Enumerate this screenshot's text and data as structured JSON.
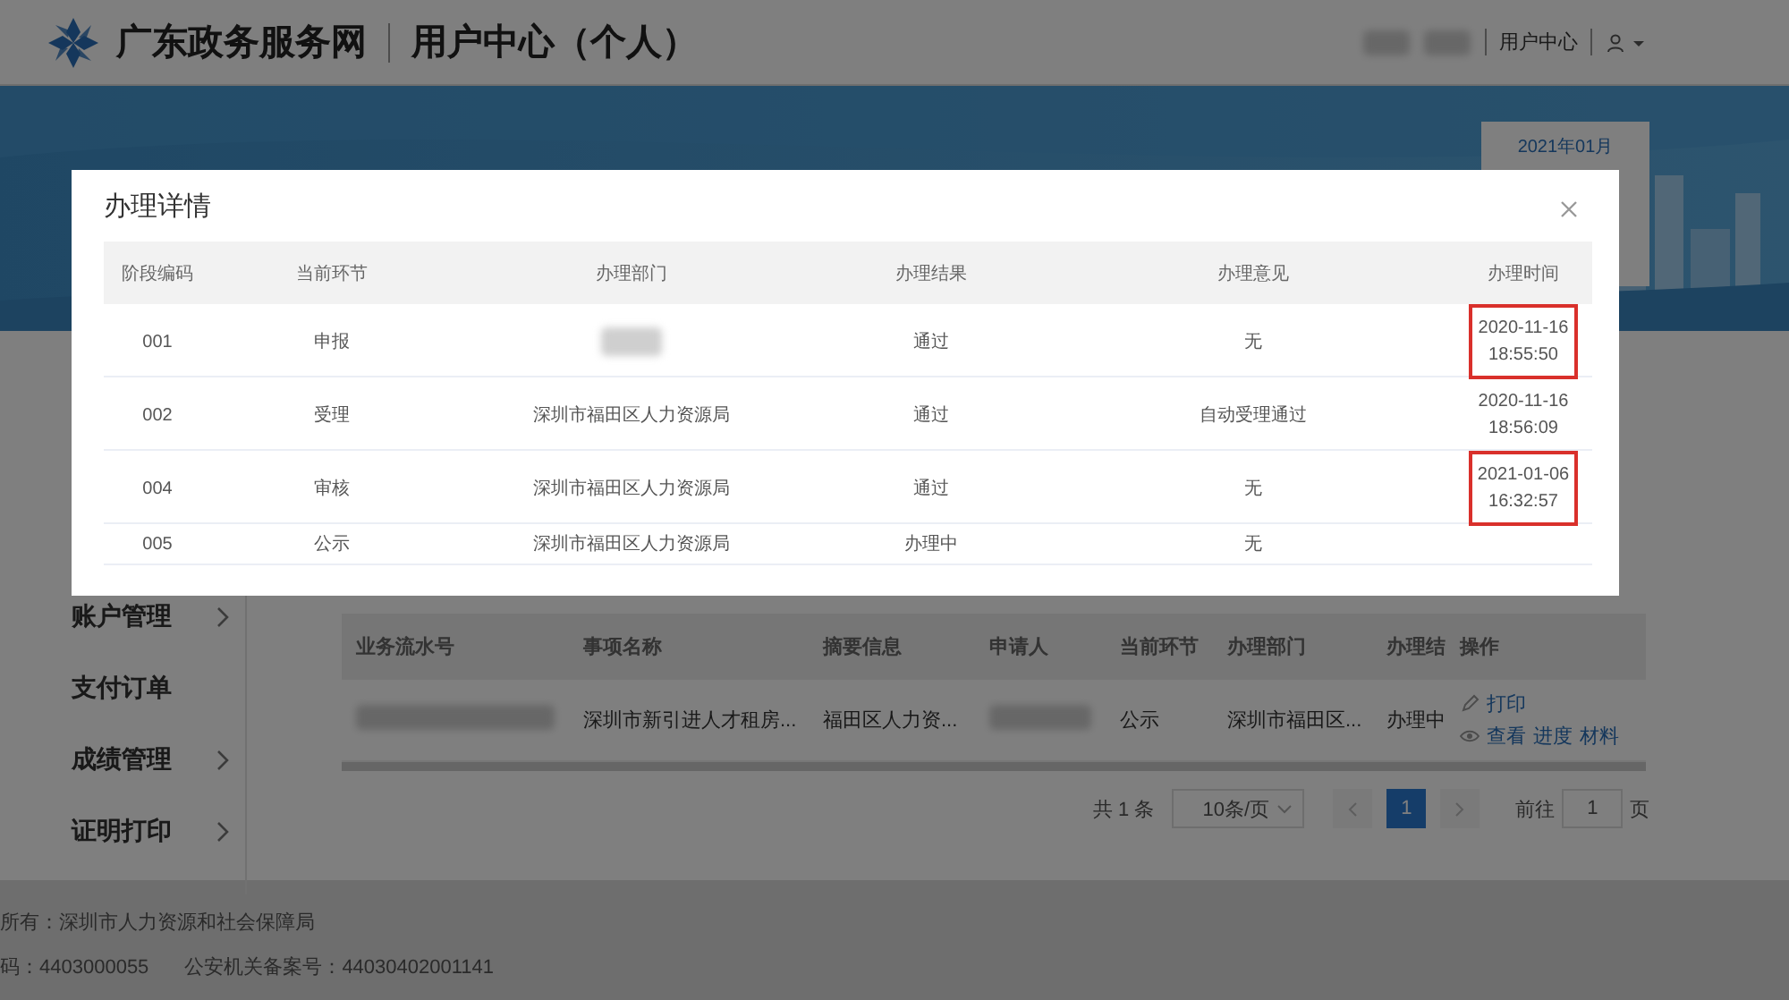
{
  "header": {
    "site_title": "广东政务服务网",
    "section_title": "用户中心（个人）",
    "user_link": "用户中心"
  },
  "banner": {
    "calendar_month": "2021年01月"
  },
  "sidebar": {
    "items": [
      {
        "label": "账户管理",
        "expandable": true
      },
      {
        "label": "支付订单",
        "expandable": false
      },
      {
        "label": "成绩管理",
        "expandable": true
      },
      {
        "label": "证明打印",
        "expandable": true
      }
    ]
  },
  "table": {
    "columns": [
      "业务流水号",
      "事项名称",
      "摘要信息",
      "申请人",
      "当前环节",
      "办理部门",
      "办理结",
      "操作"
    ],
    "rows": [
      {
        "cells": [
          {
            "kind": "redacted"
          },
          {
            "kind": "text",
            "text": "深圳市新引进人才租房..."
          },
          {
            "kind": "text",
            "text": "福田区人力资..."
          },
          {
            "kind": "redacted"
          },
          {
            "kind": "text",
            "text": "公示"
          },
          {
            "kind": "text",
            "text": "深圳市福田区..."
          },
          {
            "kind": "text",
            "text": "办理中"
          }
        ],
        "actions": [
          {
            "kind": "print",
            "links": [
              "打印"
            ]
          },
          {
            "kind": "view",
            "links": [
              "查看",
              "进度",
              "材料"
            ]
          }
        ]
      }
    ]
  },
  "pagination": {
    "total": "共 1 条",
    "page_size": "10条/页",
    "pages": [
      {
        "label": "1",
        "selected": true
      }
    ],
    "goto_label": "前往",
    "goto_value": "1",
    "goto_suffix": "页"
  },
  "footer": {
    "owner": "所有：深圳市人力资源和社会保障局",
    "records": [
      "码：4403000055",
      "公安机关备案号：44030402001141"
    ]
  },
  "modal": {
    "title": "办理详情",
    "columns": [
      "阶段编码",
      "当前环节",
      "办理部门",
      "办理结果",
      "办理意见",
      "办理时间"
    ],
    "rows": [
      {
        "cells": [
          {
            "kind": "text",
            "text": "001"
          },
          {
            "kind": "text",
            "text": "申报"
          },
          {
            "kind": "redacted"
          },
          {
            "kind": "text",
            "text": "通过"
          },
          {
            "kind": "text",
            "text": "无"
          },
          {
            "kind": "lines",
            "lines": [
              "2020-11-16",
              "18:55:50"
            ],
            "highlighted": true
          }
        ]
      },
      {
        "cells": [
          {
            "kind": "text",
            "text": "002"
          },
          {
            "kind": "text",
            "text": "受理"
          },
          {
            "kind": "text",
            "text": "深圳市福田区人力资源局"
          },
          {
            "kind": "text",
            "text": "通过"
          },
          {
            "kind": "text",
            "text": "自动受理通过"
          },
          {
            "kind": "lines",
            "lines": [
              "2020-11-16",
              "18:56:09"
            ],
            "highlighted": false
          }
        ]
      },
      {
        "cells": [
          {
            "kind": "text",
            "text": "004"
          },
          {
            "kind": "text",
            "text": "审核"
          },
          {
            "kind": "text",
            "text": "深圳市福田区人力资源局"
          },
          {
            "kind": "text",
            "text": "通过"
          },
          {
            "kind": "text",
            "text": "无"
          },
          {
            "kind": "lines",
            "lines": [
              "2021-01-06",
              "16:32:57"
            ],
            "highlighted": true
          }
        ]
      },
      {
        "cells": [
          {
            "kind": "text",
            "text": "005"
          },
          {
            "kind": "text",
            "text": "公示"
          },
          {
            "kind": "text",
            "text": "深圳市福田区人力资源局"
          },
          {
            "kind": "text",
            "text": "办理中"
          },
          {
            "kind": "text",
            "text": "无"
          }
        ]
      }
    ]
  }
}
